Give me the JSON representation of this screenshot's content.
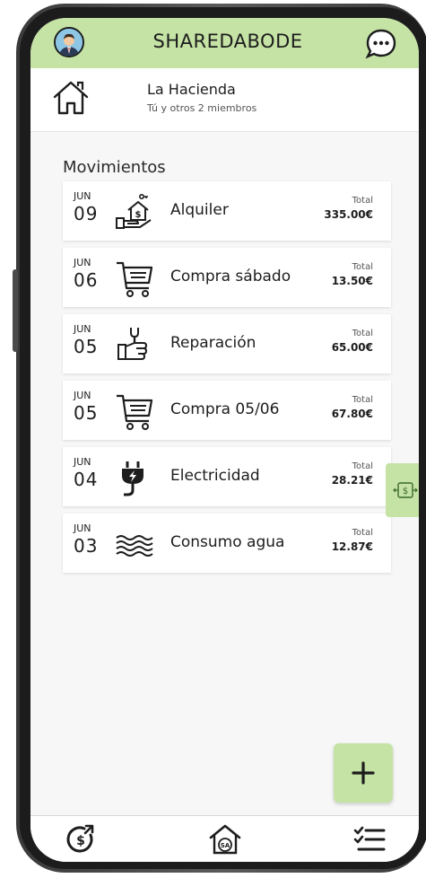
{
  "app": {
    "title": "SHAREDABODE",
    "accent_color": "#c5e3a5"
  },
  "topbar": {
    "avatar_icon": "user-avatar-icon",
    "chat_icon": "chat-bubble-icon"
  },
  "group": {
    "icon": "house-icon",
    "name": "La Hacienda",
    "members": "Tú y otros 2 miembros"
  },
  "movimientos": {
    "title": "Movimientos",
    "total_label": "Total",
    "items": [
      {
        "month": "JUN",
        "day": "09",
        "icon": "rent-hand-house-icon",
        "name": "Alquiler",
        "total": "335.00€"
      },
      {
        "month": "JUN",
        "day": "06",
        "icon": "shopping-cart-icon",
        "name": "Compra sábado",
        "total": "13.50€"
      },
      {
        "month": "JUN",
        "day": "05",
        "icon": "repair-wrench-hand-icon",
        "name": "Reparación",
        "total": "65.00€"
      },
      {
        "month": "JUN",
        "day": "05",
        "icon": "shopping-cart-icon",
        "name": "Compra 05/06",
        "total": "67.80€"
      },
      {
        "month": "JUN",
        "day": "04",
        "icon": "electric-plug-icon",
        "name": "Electricidad",
        "total": "28.21€"
      },
      {
        "month": "JUN",
        "day": "03",
        "icon": "water-waves-icon",
        "name": "Consumo agua",
        "total": "12.87€"
      }
    ]
  },
  "side_tab": {
    "icon": "money-transfer-icon"
  },
  "fab": {
    "label": "+"
  },
  "bottom_nav": {
    "items": [
      {
        "icon": "dollar-circle-arrow-icon"
      },
      {
        "icon": "house-sa-icon",
        "label": "SA"
      },
      {
        "icon": "checklist-icon"
      }
    ]
  }
}
